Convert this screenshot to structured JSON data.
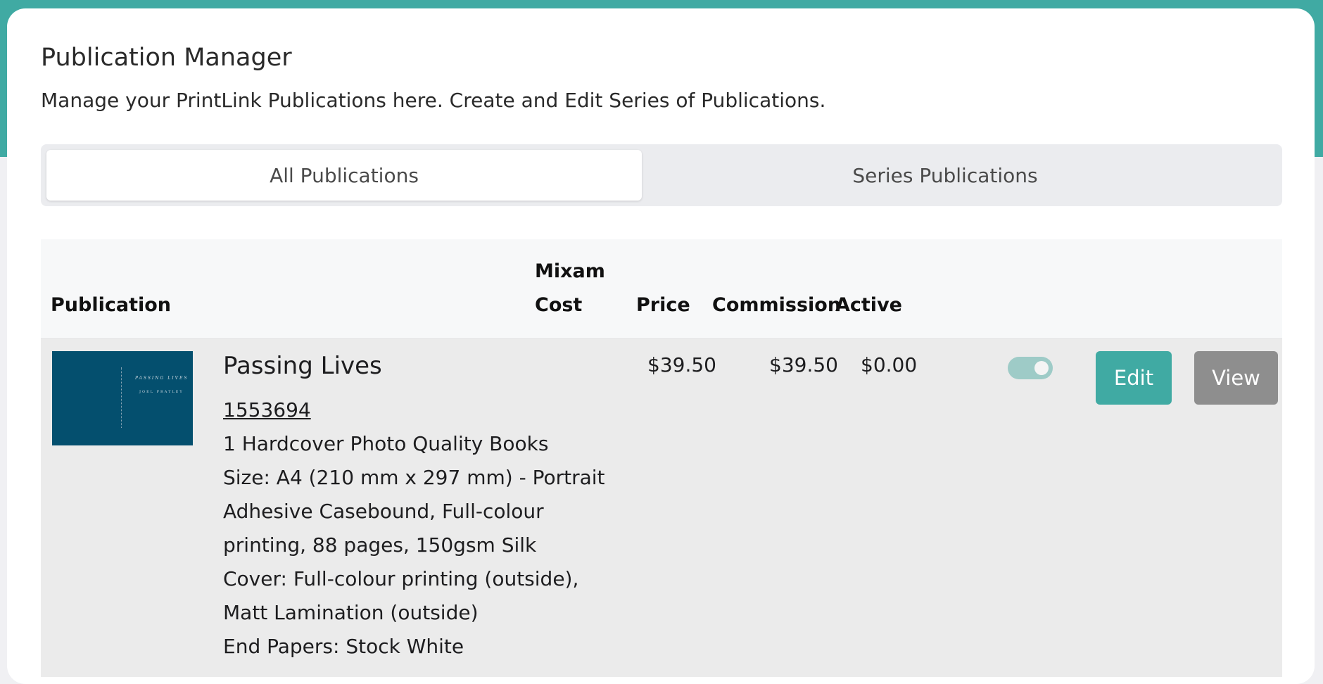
{
  "header": {
    "title": "Publication Manager",
    "subtitle": "Manage your PrintLink Publications here. Create and Edit Series of Publications."
  },
  "tabs": [
    {
      "label": "All Publications",
      "active": true
    },
    {
      "label": "Series Publications",
      "active": false
    }
  ],
  "table": {
    "columns": [
      "Publication",
      "Mixam\nCost",
      "Price",
      "Commission",
      "Active"
    ],
    "rows": [
      {
        "cover_title": "PASSING LIVES",
        "cover_author": "JOEL PRATLEY",
        "name": "Passing Lives",
        "id": "1553694",
        "details": [
          "1 Hardcover Photo Quality Books",
          "Size: A4 (210 mm x 297 mm) - Portrait",
          "Adhesive Casebound, Full-colour",
          "printing, 88 pages, 150gsm Silk",
          "Cover: Full-colour printing (outside),",
          "Matt Lamination (outside)",
          "End Papers: Stock White"
        ],
        "mixam_cost": "$39.50",
        "price": "$39.50",
        "commission": "$0.00",
        "active": true,
        "edit_label": "Edit",
        "view_label": "View"
      }
    ]
  },
  "colors": {
    "accent": "#40aaa3",
    "view": "#8e8e8e"
  }
}
